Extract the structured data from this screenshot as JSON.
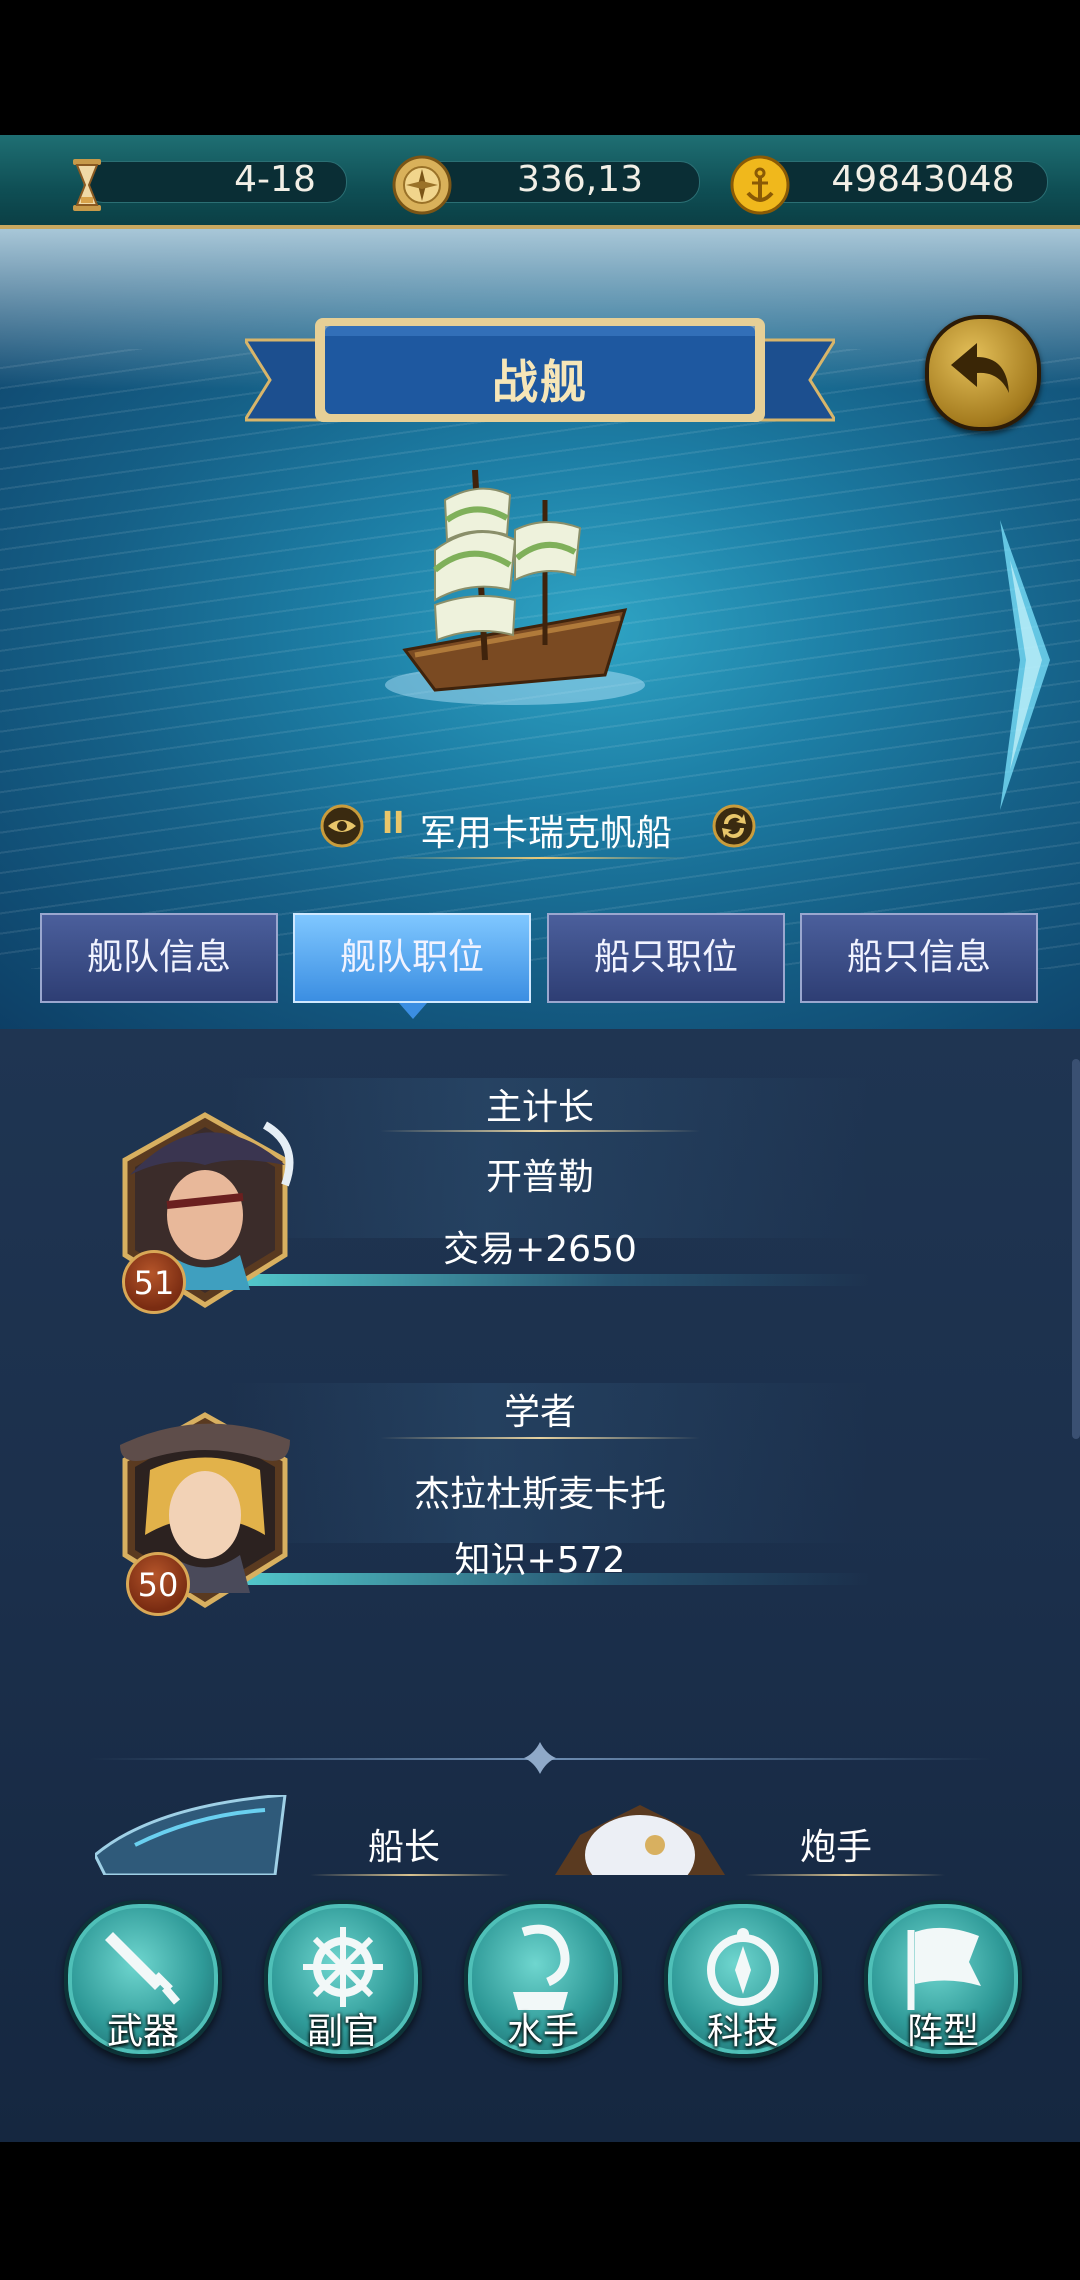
{
  "resources": {
    "time": "4-18",
    "compass": "336,13",
    "gold": "49843048"
  },
  "header": {
    "title": "战舰"
  },
  "ship": {
    "tier": "II",
    "name": "军用卡瑞克帆船"
  },
  "tabs": [
    {
      "label": "舰队信息",
      "active": false
    },
    {
      "label": "舰队职位",
      "active": true
    },
    {
      "label": "船只职位",
      "active": false
    },
    {
      "label": "船只信息",
      "active": false
    }
  ],
  "officers": [
    {
      "role": "主计长",
      "name": "开普勒",
      "stat": "交易+2650",
      "level": "51"
    },
    {
      "role": "学者",
      "name": "杰拉杜斯麦卡托",
      "stat": "知识+572",
      "level": "50"
    }
  ],
  "lower_roles": [
    {
      "role": "船长"
    },
    {
      "role": "炮手"
    }
  ],
  "actions": [
    {
      "label": "武器",
      "icon": "sword-icon"
    },
    {
      "label": "副官",
      "icon": "ship-wheel-icon"
    },
    {
      "label": "水手",
      "icon": "hook-icon"
    },
    {
      "label": "科技",
      "icon": "compass-icon"
    },
    {
      "label": "阵型",
      "icon": "flag-icon"
    }
  ],
  "colors": {
    "accent_gold": "#e9c66a",
    "tab_active": "#3b8ee2",
    "tab_inactive": "#2e3e74"
  }
}
